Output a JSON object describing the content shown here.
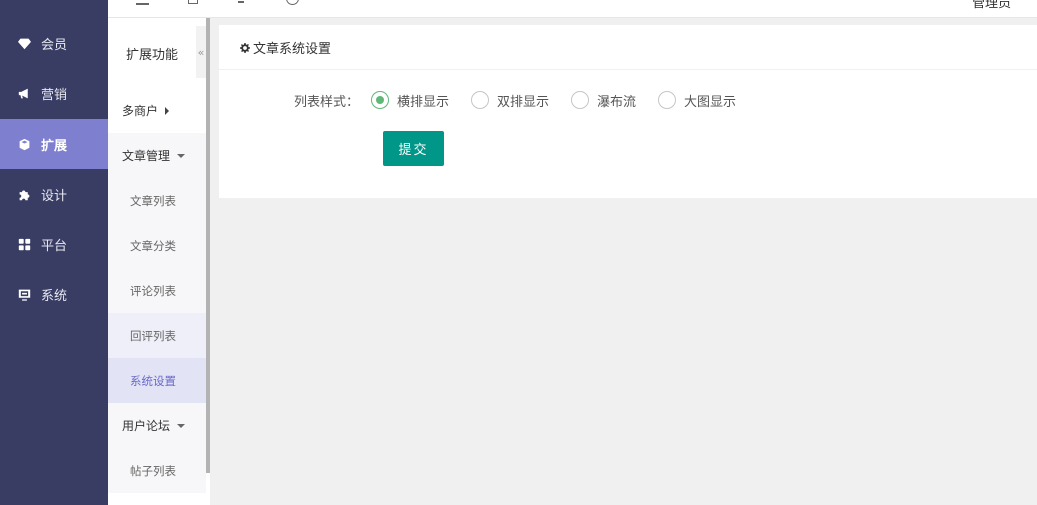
{
  "topbar": {
    "user_label": "管理员"
  },
  "sidebar": {
    "items": [
      {
        "label": "会员",
        "icon": "gem-icon",
        "active": false
      },
      {
        "label": "营销",
        "icon": "megaphone-icon",
        "active": false
      },
      {
        "label": "扩展",
        "icon": "cube-icon",
        "active": true
      },
      {
        "label": "设计",
        "icon": "puzzle-icon",
        "active": false
      },
      {
        "label": "平台",
        "icon": "grid-icon",
        "active": false
      },
      {
        "label": "系统",
        "icon": "monitor-icon",
        "active": false
      }
    ]
  },
  "subbar": {
    "title": "扩展功能",
    "collapse_symbol": "«",
    "items": [
      {
        "label": "多商户",
        "type": "group-collapsed"
      },
      {
        "label": "文章管理",
        "type": "group-expanded"
      },
      {
        "label": "文章列表",
        "type": "child"
      },
      {
        "label": "文章分类",
        "type": "child"
      },
      {
        "label": "评论列表",
        "type": "child"
      },
      {
        "label": "回评列表",
        "type": "child"
      },
      {
        "label": "系统设置",
        "type": "child-selected"
      },
      {
        "label": "用户论坛",
        "type": "group-expanded"
      },
      {
        "label": "帖子列表",
        "type": "child"
      }
    ]
  },
  "card": {
    "title": "文章系统设置",
    "form": {
      "label": "列表样式：",
      "options": [
        {
          "label": "横排显示",
          "checked": true
        },
        {
          "label": "双排显示",
          "checked": false
        },
        {
          "label": "瀑布流",
          "checked": false
        },
        {
          "label": "大图显示",
          "checked": false
        }
      ],
      "submit_label": "提交"
    }
  },
  "colors": {
    "sidebar_bg": "#393d64",
    "sidebar_active": "#7f7fcf",
    "primary_button": "#009688",
    "radio_checked": "#5fb878"
  }
}
